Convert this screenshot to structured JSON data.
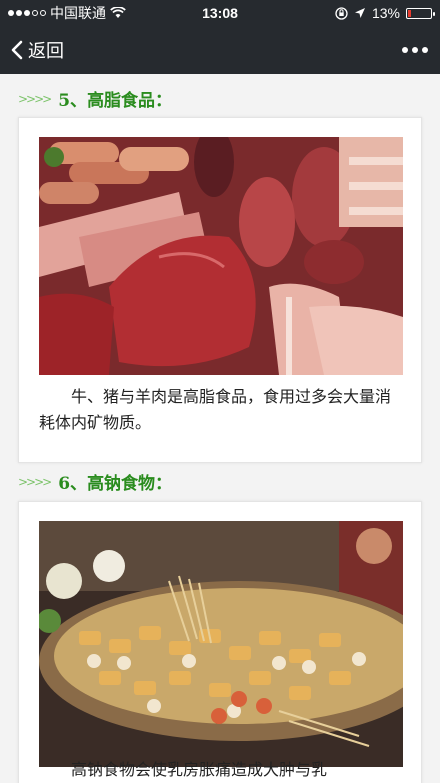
{
  "status_bar": {
    "carrier": "中国联通",
    "time": "13:08",
    "battery_percent": "13%",
    "battery_level": 0.13,
    "icons": [
      "signal-dots-icon",
      "wifi-icon",
      "orientation-lock-icon",
      "location-arrow-icon",
      "battery-icon"
    ]
  },
  "nav": {
    "back_label": "返回",
    "icons": [
      "chevron-left-icon",
      "more-dots-icon"
    ]
  },
  "sections": [
    {
      "number": "5、",
      "title": "高脂食品：",
      "caption": "牛、猪与羊肉是高脂食品，食用过多会大量消耗体内矿物质。"
    },
    {
      "number": "6、",
      "title": "高钠食物：",
      "caption": "高钠食物会使乳房胀痛造成大肿与乳"
    }
  ],
  "colors": {
    "title_green": "#2a8c1e",
    "chevron_green": "#7cc36a",
    "bar_dark": "#262a2f",
    "battery_red": "#e63b2e"
  }
}
